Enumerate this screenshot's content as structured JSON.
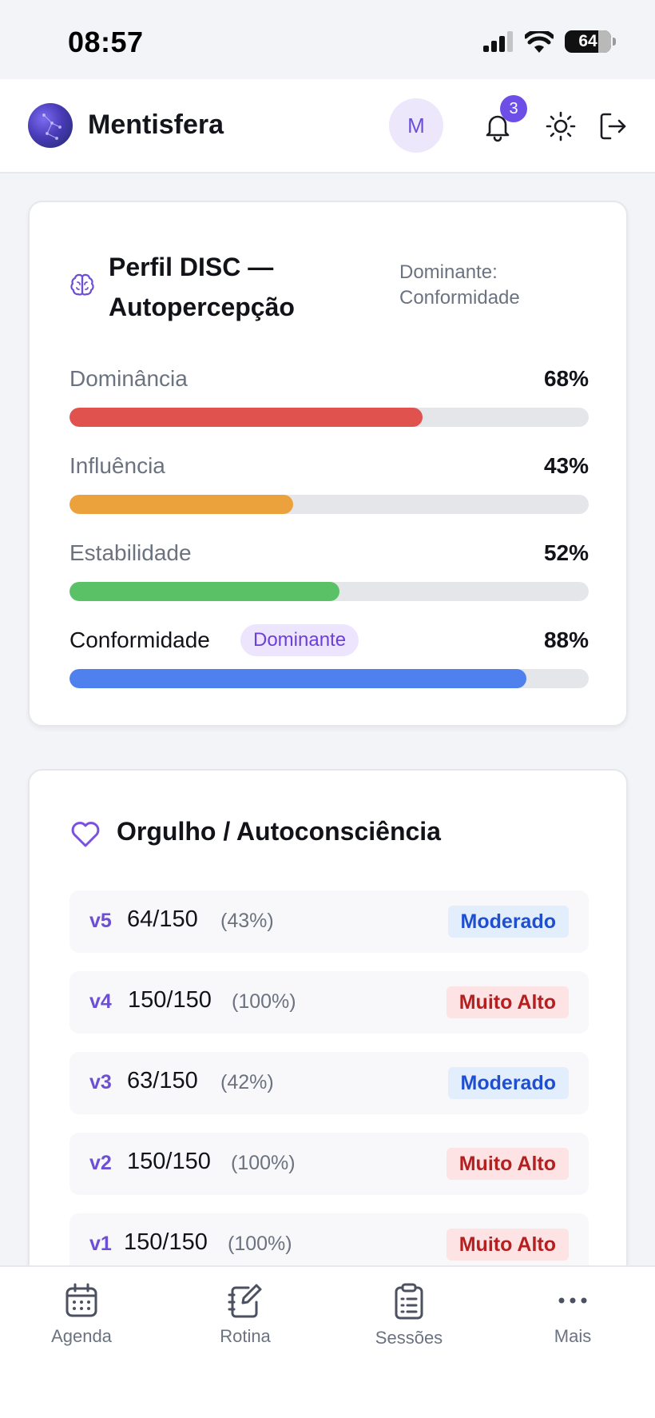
{
  "status_bar": {
    "time": "08:57",
    "battery": "64"
  },
  "header": {
    "app_name": "Mentisfera",
    "avatar_initial": "M",
    "notification_count": "3"
  },
  "disc": {
    "title": "Perfil DISC — Autopercepção",
    "dominant_label": "Dominante: Conformidade",
    "dominant_tag": "Dominante",
    "traits": [
      {
        "label": "Dominância",
        "value": "68%",
        "percent": 68,
        "color": "#e0524e"
      },
      {
        "label": "Influência",
        "value": "43%",
        "percent": 43,
        "color": "#eca23c"
      },
      {
        "label": "Estabilidade",
        "value": "52%",
        "percent": 52,
        "color": "#5bc166"
      },
      {
        "label": "Conformidade",
        "value": "88%",
        "percent": 88,
        "color": "#4f81ee"
      }
    ]
  },
  "pride": {
    "title": "Orgulho / Autoconsciência",
    "rows": [
      {
        "version": "v5",
        "score": "64/150",
        "percent": "(43%)",
        "level": "Moderado"
      },
      {
        "version": "v4",
        "score": "150/150",
        "percent": "(100%)",
        "level": "Muito Alto"
      },
      {
        "version": "v3",
        "score": "63/150",
        "percent": "(42%)",
        "level": "Moderado"
      },
      {
        "version": "v2",
        "score": "150/150",
        "percent": "(100%)",
        "level": "Muito Alto"
      },
      {
        "version": "v1",
        "score": "150/150",
        "percent": "(100%)",
        "level": "Muito Alto"
      }
    ]
  },
  "nav": {
    "items": [
      {
        "label": "Agenda",
        "icon": "calendar-icon"
      },
      {
        "label": "Rotina",
        "icon": "notebook-edit-icon"
      },
      {
        "label": "Sessões",
        "icon": "clipboard-icon"
      },
      {
        "label": "Mais",
        "icon": "more-dots-icon"
      }
    ]
  }
}
